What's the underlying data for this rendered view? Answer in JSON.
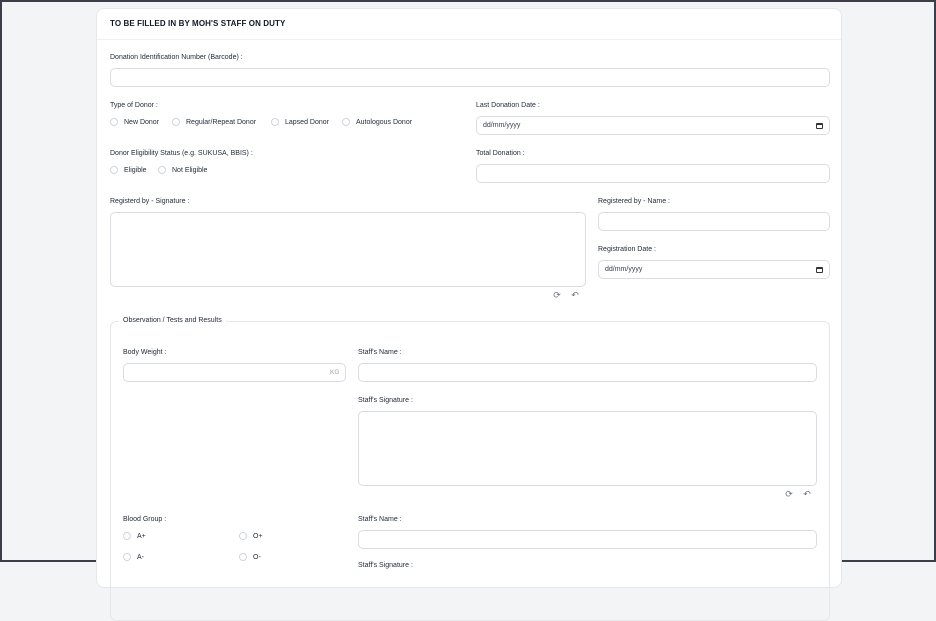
{
  "section_title": "TO BE FILLED IN BY MOH'S STAFF ON DUTY",
  "donation_id": {
    "label": "Donation Identification Number (Barcode) :",
    "value": ""
  },
  "donor_type": {
    "label": "Type of Donor :",
    "options": [
      "New Donor",
      "Regular/Repeat Donor",
      "Lapsed Donor",
      "Autologous Donor"
    ]
  },
  "last_donation": {
    "label": "Last Donation Date :",
    "placeholder": "dd/mm/yyyy"
  },
  "eligibility": {
    "label": "Donor Eligibility Status (e.g. SUKUSA, BBIS) :",
    "options": [
      "Eligible",
      "Not Eligible"
    ]
  },
  "total_donation": {
    "label": "Total Donation :",
    "value": ""
  },
  "registered_signature": {
    "label": "Registerd by - Signature :",
    "refresh_icon": "refresh-icon",
    "undo_icon": "undo-icon"
  },
  "registered_name": {
    "label": "Registered by - Name :",
    "value": ""
  },
  "registration_date": {
    "label": "Registration Date :",
    "placeholder": "dd/mm/yyyy"
  },
  "observation": {
    "legend": "Observation / Tests and Results",
    "body_weight": {
      "label": "Body Weight :",
      "unit": "KG",
      "value": ""
    },
    "staff_name_1": {
      "label": "Staff's Name :",
      "value": ""
    },
    "staff_signature_1": {
      "label": "Staff's Signature :"
    },
    "blood_group": {
      "label": "Blood Group :",
      "options": [
        "A+",
        "O+",
        "A-",
        "O-"
      ]
    },
    "staff_name_2": {
      "label": "Staff's Name :",
      "value": ""
    },
    "staff_signature_2": {
      "label": "Staff's Signature :"
    }
  }
}
